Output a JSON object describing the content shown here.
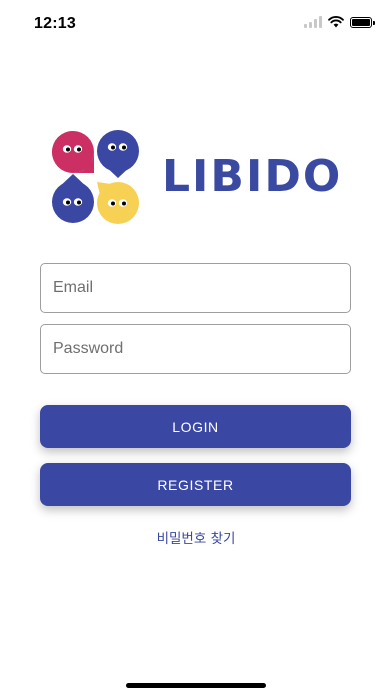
{
  "status_bar": {
    "time": "12:13",
    "icons": [
      "signal-icon",
      "wifi-icon",
      "battery-icon"
    ]
  },
  "brand": {
    "name": "LIBIDO",
    "color": "#3a4aa0",
    "mascot_colors": [
      "#cc2f63",
      "#3a47a3",
      "#3a47a3",
      "#f6d154"
    ]
  },
  "form": {
    "email_placeholder": "Email",
    "email_value": "",
    "password_placeholder": "Password",
    "password_value": ""
  },
  "buttons": {
    "login_label": "LOGIN",
    "register_label": "REGISTER",
    "color": "#3a47a3"
  },
  "links": {
    "find_password": "비밀번호 찾기"
  }
}
